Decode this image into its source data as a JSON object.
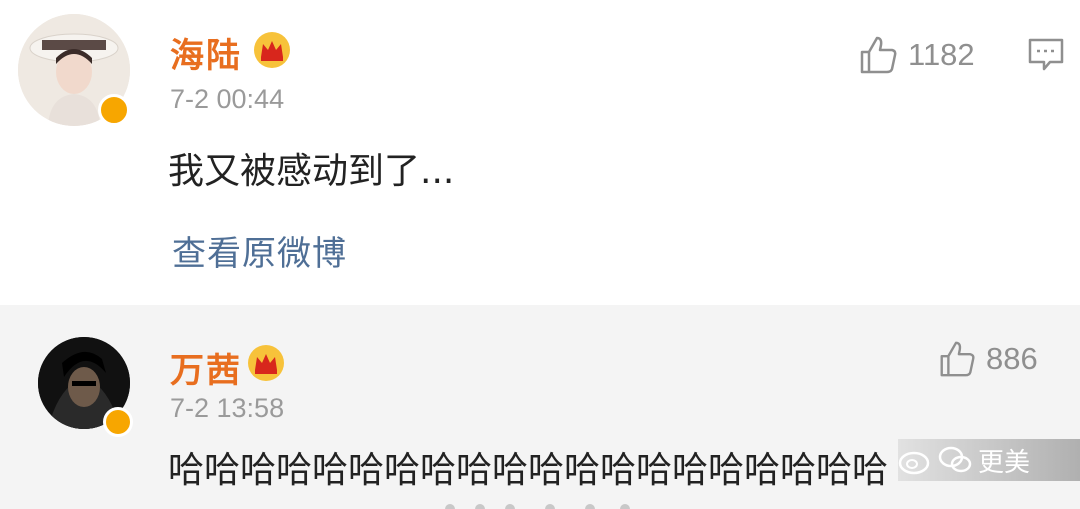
{
  "comments": [
    {
      "user": "海陆",
      "time": "7-2 00:44",
      "text": "我又被感动到了...",
      "likes": "1182",
      "link": "查看原微博"
    },
    {
      "user": "万茜",
      "time": "7-2 13:58",
      "text": "哈哈哈哈哈哈哈哈哈哈哈哈哈哈哈哈哈哈哈哈",
      "likes": "886"
    }
  ],
  "watermark": {
    "label": "更美"
  },
  "colors": {
    "name": "#e86e1f",
    "link": "#4f6f96",
    "muted": "#9a9a9a",
    "badge": "#f7a600"
  },
  "icons": [
    "thumbs-up-icon",
    "reply-icon",
    "crown-icon",
    "verified-badge-icon",
    "weibo-icon",
    "wechat-icon"
  ]
}
